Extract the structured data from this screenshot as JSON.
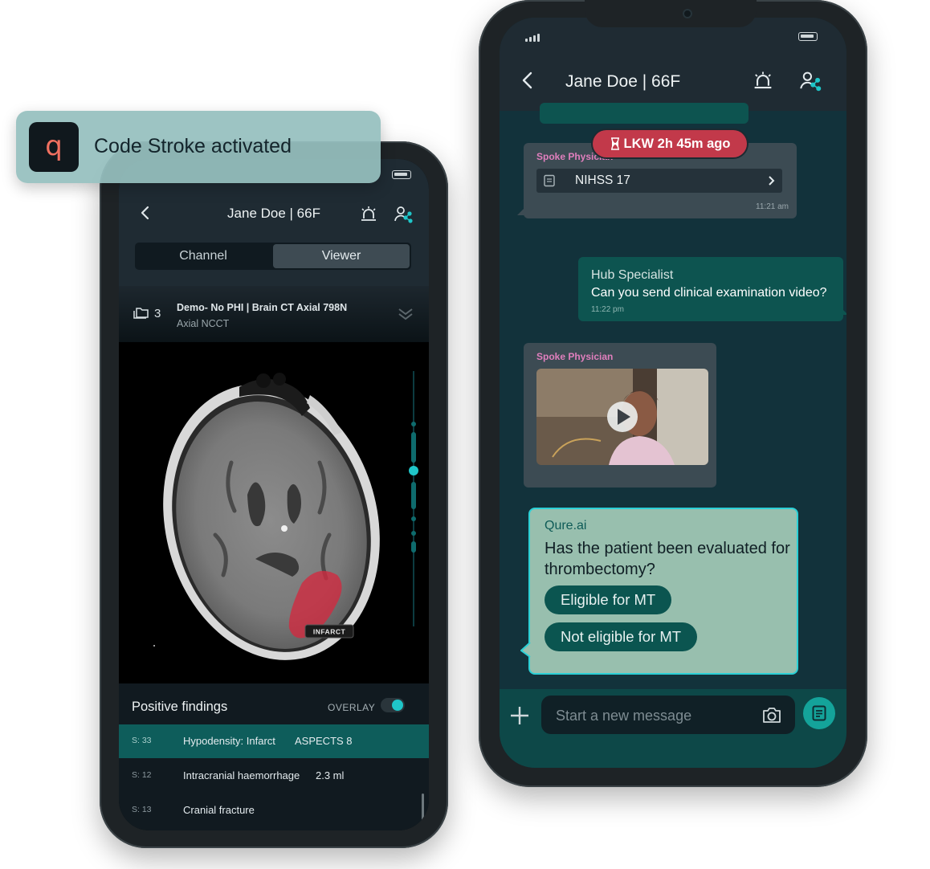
{
  "colors": {
    "accent": "#1fc6c9",
    "alert": "#c2394a",
    "spoke_name": "#e07fbd",
    "finding_selected": "#0e5d5b",
    "qure_bubble": "#98bfae"
  },
  "toast": {
    "message": "Code Stroke activated",
    "logo_letter": "q",
    "icon": "qure-logo-icon"
  },
  "left_phone": {
    "header": {
      "title": "Jane Doe | 66F",
      "back_icon": "chevron-left-icon",
      "alarm_icon": "siren-icon",
      "team_icon": "team-share-icon"
    },
    "tabs": [
      {
        "label": "Channel",
        "active": false
      },
      {
        "label": "Viewer",
        "active": true
      }
    ],
    "study": {
      "series_count": "3",
      "title": "Demo- No PHI | Brain CT Axial 798N",
      "subtitle": "Axial NCCT"
    },
    "viewer": {
      "annotation": "INFARCT"
    },
    "findings": {
      "header": "Positive findings",
      "overlay_label": "OVERLAY",
      "overlay_on": true,
      "rows": [
        {
          "slice": "S: 33",
          "name": "Hypodensity: Infarct",
          "value": "ASPECTS 8",
          "selected": true
        },
        {
          "slice": "S: 12",
          "name": "Intracranial haemorrhage",
          "value": "2.3 ml",
          "selected": false
        },
        {
          "slice": "S: 13",
          "name": "Cranial fracture",
          "value": "",
          "selected": false
        }
      ]
    }
  },
  "right_phone": {
    "header": {
      "title": "Jane Doe | 66F",
      "back_icon": "chevron-left-icon",
      "alarm_icon": "siren-icon",
      "team_icon": "team-share-icon"
    },
    "lkw_badge": "LKW 2h 45m ago",
    "messages": {
      "m1": {
        "sender": "Spoke Physician",
        "attachment": "NIHSS 17",
        "time": "11:21 am"
      },
      "m2": {
        "sender": "Hub Specialist",
        "text": "Can you send clinical examination video?",
        "time": "11:22 pm"
      },
      "m3": {
        "sender": "Spoke Physician",
        "attachment": "video"
      },
      "m4": {
        "sender": "Qure.ai",
        "question": "Has the patient been evaluated for thrombectomy?",
        "options": [
          "Eligible for MT",
          "Not eligible for MT"
        ]
      }
    },
    "composer": {
      "placeholder": "Start a new message",
      "add_icon": "plus-icon",
      "camera_icon": "camera-icon",
      "notes_icon": "notes-icon"
    }
  }
}
